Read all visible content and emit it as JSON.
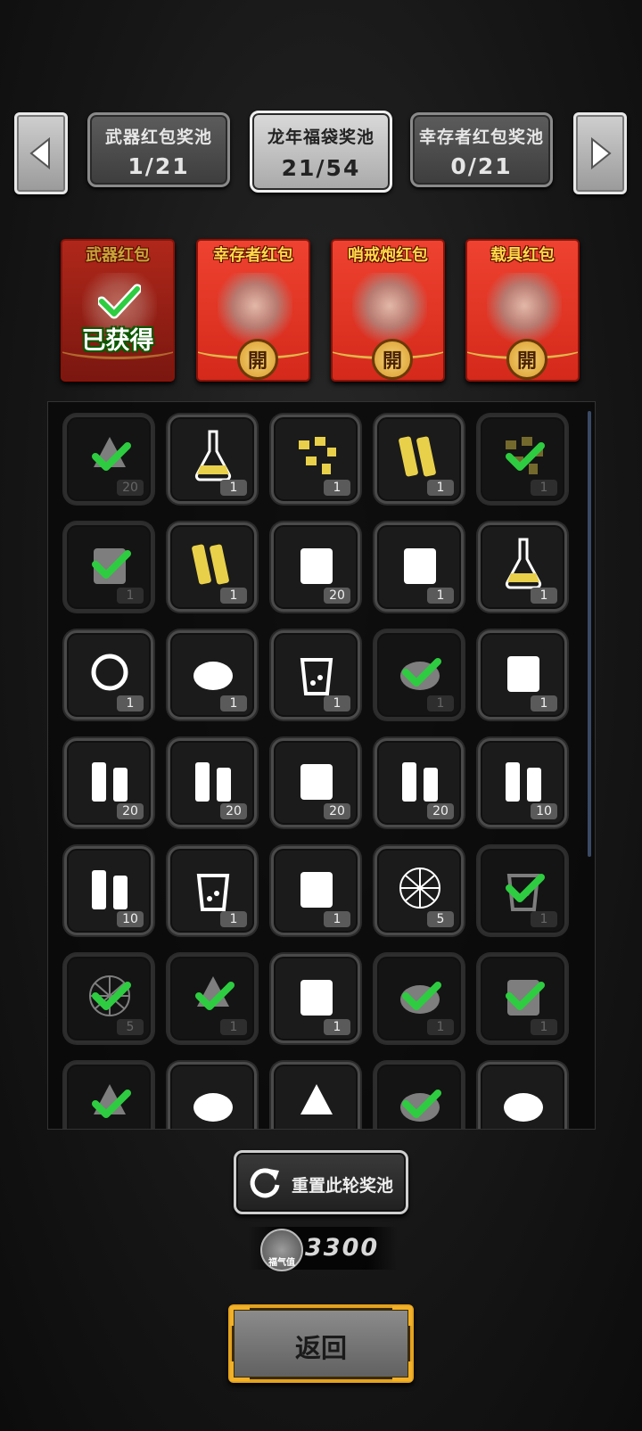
{
  "nav": {
    "prev_icon": "triangle-left-icon",
    "next_icon": "triangle-right-icon",
    "tabs": [
      {
        "name": "武器红包奖池",
        "count": "1/21",
        "active": false
      },
      {
        "name": "龙年福袋奖池",
        "count": "21/54",
        "active": true
      },
      {
        "name": "幸存者红包奖池",
        "count": "0/21",
        "active": false
      }
    ]
  },
  "envelopes": [
    {
      "name": "武器红包",
      "status": "已获得",
      "obtained": true
    },
    {
      "name": "幸存者红包",
      "seal": "開",
      "obtained": false
    },
    {
      "name": "哨戒炮红包",
      "seal": "開",
      "obtained": false
    },
    {
      "name": "载具红包",
      "seal": "開",
      "obtained": false
    }
  ],
  "items": [
    {
      "icon": "wrench-icon",
      "count": "20",
      "claimed": true
    },
    {
      "icon": "flask-icon",
      "count": "1",
      "claimed": false
    },
    {
      "icon": "gold-nuggets-icon",
      "count": "1",
      "claimed": false
    },
    {
      "icon": "gold-wood-icon",
      "count": "1",
      "claimed": false
    },
    {
      "icon": "gold-scrap-icon",
      "count": "1",
      "claimed": true
    },
    {
      "icon": "map-icon",
      "count": "1",
      "claimed": true
    },
    {
      "icon": "chopsticks-icon",
      "count": "1",
      "claimed": false
    },
    {
      "icon": "cash-bundle-icon",
      "count": "20",
      "claimed": false
    },
    {
      "icon": "gold-bars-icon",
      "count": "1",
      "claimed": false
    },
    {
      "icon": "vase-icon",
      "count": "1",
      "claimed": false
    },
    {
      "icon": "ring-icon",
      "count": "1",
      "claimed": false
    },
    {
      "icon": "sugar-bowl-icon",
      "count": "1",
      "claimed": false
    },
    {
      "icon": "coffee-cup-icon",
      "count": "1",
      "claimed": false
    },
    {
      "icon": "fruit-bowl-icon",
      "count": "1",
      "claimed": true
    },
    {
      "icon": "tool-bag-icon",
      "count": "1",
      "claimed": false
    },
    {
      "icon": "battery-icon",
      "count": "20",
      "claimed": false
    },
    {
      "icon": "pistol-ammo-icon",
      "count": "20",
      "claimed": false
    },
    {
      "icon": "fuel-barrel-icon",
      "count": "20",
      "claimed": false
    },
    {
      "icon": "rifle-ammo-icon",
      "count": "20",
      "claimed": false
    },
    {
      "icon": "shotgun-shells-icon",
      "count": "10",
      "claimed": false
    },
    {
      "icon": "heavy-ammo-icon",
      "count": "10",
      "claimed": false
    },
    {
      "icon": "drink-glass-icon",
      "count": "1",
      "claimed": false
    },
    {
      "icon": "pickle-jar-icon",
      "count": "1",
      "claimed": false
    },
    {
      "icon": "net-trap-icon",
      "count": "5",
      "claimed": false
    },
    {
      "icon": "juice-glass-icon",
      "count": "1",
      "claimed": true
    },
    {
      "icon": "dome-net-icon",
      "count": "5",
      "claimed": true
    },
    {
      "icon": "scratch-icon",
      "count": "1",
      "claimed": true
    },
    {
      "icon": "cloth-stack-icon",
      "count": "1",
      "claimed": false
    },
    {
      "icon": "ore-rock-icon",
      "count": "1",
      "claimed": true
    },
    {
      "icon": "medicine-bottle-icon",
      "count": "1",
      "claimed": true
    },
    {
      "icon": "gun-part-icon",
      "count": "",
      "claimed": true
    },
    {
      "icon": "meat-icon",
      "count": "",
      "claimed": false
    },
    {
      "icon": "syringe-icon",
      "count": "",
      "claimed": false
    },
    {
      "icon": "fruit-bowl-icon",
      "count": "",
      "claimed": true
    },
    {
      "icon": "fish-icon",
      "count": "",
      "claimed": false
    }
  ],
  "reset": {
    "label": "重置此轮奖池",
    "icon": "refresh-icon"
  },
  "fortune": {
    "icon_text": "福气值",
    "value": "3300"
  },
  "back": {
    "label": "返回"
  },
  "colors": {
    "accent_gold": "#e3a21f",
    "envelope_red": "#e33a28",
    "check_green": "#2ecc40"
  }
}
